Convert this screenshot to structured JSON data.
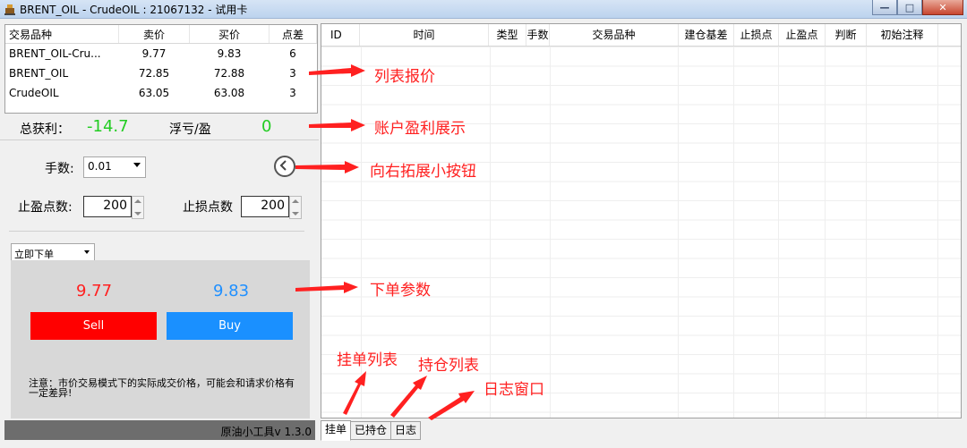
{
  "window": {
    "title": "BRENT_OIL - CrudeOIL : 21067132 - 试用卡",
    "minimize_label": "—",
    "maximize_label": "□",
    "close_label": "✕"
  },
  "quotes": {
    "headers": [
      "交易品种",
      "卖价",
      "买价",
      "点差"
    ],
    "rows": [
      {
        "symbol": "BRENT_OIL-Cru...",
        "bid": "9.77",
        "ask": "9.83",
        "spread": "6"
      },
      {
        "symbol": "BRENT_OIL",
        "bid": "72.85",
        "ask": "72.88",
        "spread": "3"
      },
      {
        "symbol": "CrudeOIL",
        "bid": "63.05",
        "ask": "63.08",
        "spread": "3"
      }
    ]
  },
  "account": {
    "total_profit_label": "总获利：",
    "total_profit_value": "-14.7",
    "floating_label": "浮亏/盈",
    "floating_value": "0"
  },
  "params": {
    "lots_label": "手数:",
    "lots_value": "0.01",
    "tp_label": "止盈点数:",
    "tp_value": "200",
    "sl_label": "止损点数",
    "sl_value": "200"
  },
  "order": {
    "type_value": "立即下单",
    "sell_price": "9.77",
    "buy_price": "9.83",
    "sell_label": "Sell",
    "buy_label": "Buy",
    "note": "注意：市价交易模式下的实际成交价格，可能会和请求价格有一定差异!"
  },
  "status": {
    "version_text": "原油小工具v 1.3.0"
  },
  "grid": {
    "headers": [
      "ID",
      "时间",
      "类型",
      "手数",
      "交易品种",
      "建仓基差",
      "止损点",
      "止盈点",
      "判断",
      "初始注释"
    ]
  },
  "tabs": [
    {
      "label": "挂单"
    },
    {
      "label": "已持仓"
    },
    {
      "label": "日志"
    }
  ],
  "annotations": {
    "list_quotes": "列表报价",
    "account_profit": "账户盈利展示",
    "expand_button": "向右拓展小按钮",
    "order_params": "下单参数",
    "pending_list": "挂单列表",
    "position_list": "持仓列表",
    "log_window": "日志窗口",
    "color": "#ff2020"
  },
  "colors": {
    "profit_green": "#22cc22",
    "sell_red": "#ff0000",
    "buy_blue": "#1a90ff"
  }
}
